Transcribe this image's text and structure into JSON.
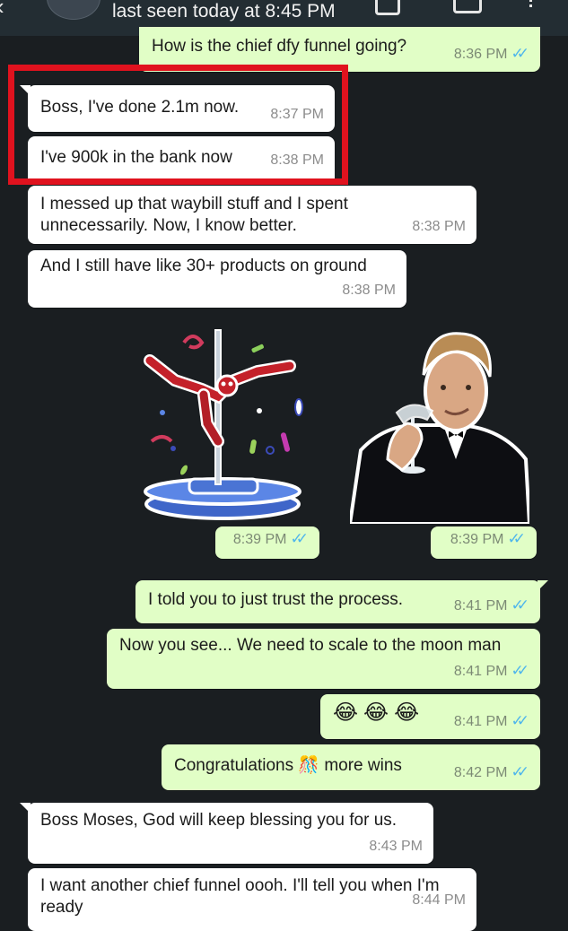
{
  "header": {
    "status": "last seen today at 8:45 PM",
    "icons": [
      "back-arrow-icon",
      "video-call-icon",
      "phone-call-icon",
      "more-options-icon"
    ]
  },
  "colors": {
    "background": "#1a1e21",
    "incoming_bubble": "#ffffff",
    "outgoing_bubble": "#e1fec6",
    "read_ticks": "#4fb6ec",
    "highlight_frame": "#e0121e"
  },
  "messages": [
    {
      "direction": "out",
      "text": "How is the chief dfy funnel going?",
      "time": "8:36 PM",
      "read": true
    },
    {
      "direction": "in",
      "text": "Boss, I've done 2.1m now.",
      "time": "8:37 PM"
    },
    {
      "direction": "in",
      "text": "I've 900k in the bank now",
      "time": "8:38 PM"
    },
    {
      "direction": "in",
      "text": "I messed up that waybill stuff and I spent unnecessarily. Now, I know better.",
      "time": "8:38 PM"
    },
    {
      "direction": "in",
      "text": "And I still have like 30+ products on ground",
      "time": "8:38 PM"
    },
    {
      "direction": "out",
      "sticker": "pole-dancing-deadpool-sticker",
      "time": "8:39 PM",
      "read": true
    },
    {
      "direction": "out",
      "sticker": "leonardo-toast-sticker",
      "time": "8:39 PM",
      "read": true
    },
    {
      "direction": "out",
      "text": "I told you to just trust the process.",
      "time": "8:41 PM",
      "read": true
    },
    {
      "direction": "out",
      "text": "Now you see... We need to scale to the moon man",
      "time": "8:41 PM",
      "read": true
    },
    {
      "direction": "out",
      "text": "😂😂😂",
      "time": "8:41 PM",
      "read": true
    },
    {
      "direction": "out",
      "text_before": "Congratulations",
      "emoji": "🎊",
      "text_after": "more wins",
      "time": "8:42 PM",
      "read": true
    },
    {
      "direction": "in",
      "text": "Boss Moses, God will keep blessing you for us.",
      "time": "8:43 PM"
    },
    {
      "direction": "in",
      "text": "I want another chief funnel oooh. I'll tell you when I'm ready",
      "time": "8:44 PM"
    }
  ]
}
